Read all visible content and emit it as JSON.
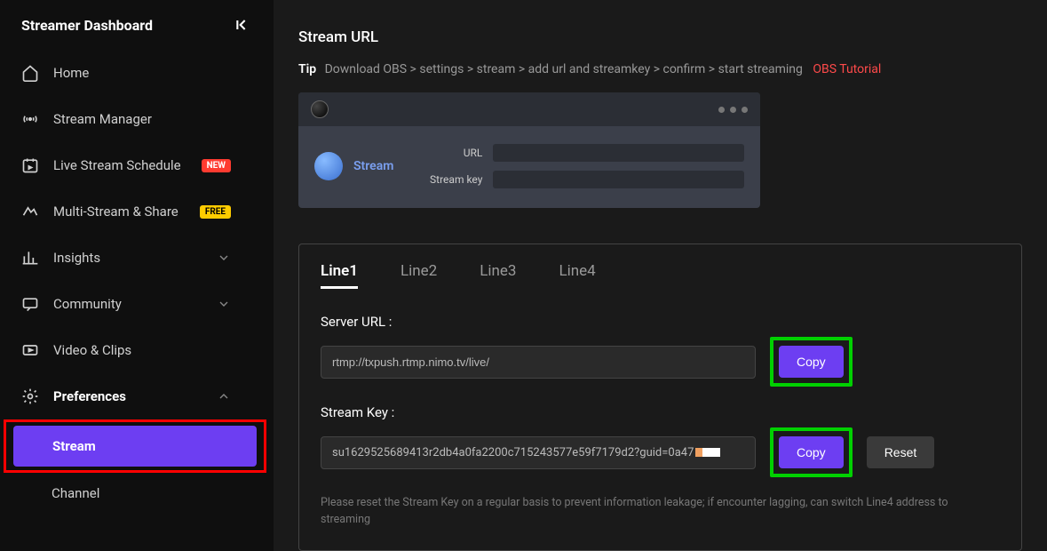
{
  "sidebar": {
    "title": "Streamer Dashboard",
    "items": {
      "home": "Home",
      "stream_manager": "Stream Manager",
      "schedule": "Live Stream Schedule",
      "multi": "Multi-Stream & Share",
      "insights": "Insights",
      "community": "Community",
      "video": "Video & Clips",
      "preferences": "Preferences"
    },
    "badges": {
      "new": "NEW",
      "free": "FREE"
    },
    "sub": {
      "stream": "Stream",
      "channel": "Channel"
    }
  },
  "main": {
    "title": "Stream URL",
    "tip_label": "Tip",
    "tip_text": "Download OBS > settings > stream > add url and streamkey > confirm > start streaming",
    "tip_link": "OBS Tutorial",
    "obs": {
      "stream": "Stream",
      "url_label": "URL",
      "key_label": "Stream key"
    },
    "tabs": [
      "Line1",
      "Line2",
      "Line3",
      "Line4"
    ],
    "server_url_label": "Server URL :",
    "server_url_value": "rtmp://txpush.rtmp.nimo.tv/live/",
    "stream_key_label": "Stream Key :",
    "stream_key_value": "su1629525689413r2db4a0fa2200c715243577e59f7179d2?guid=0a47",
    "copy": "Copy",
    "reset": "Reset",
    "note": "Please reset the Stream Key on a regular basis to prevent information leakage; if encounter lagging, can switch Line4 address to streaming"
  }
}
